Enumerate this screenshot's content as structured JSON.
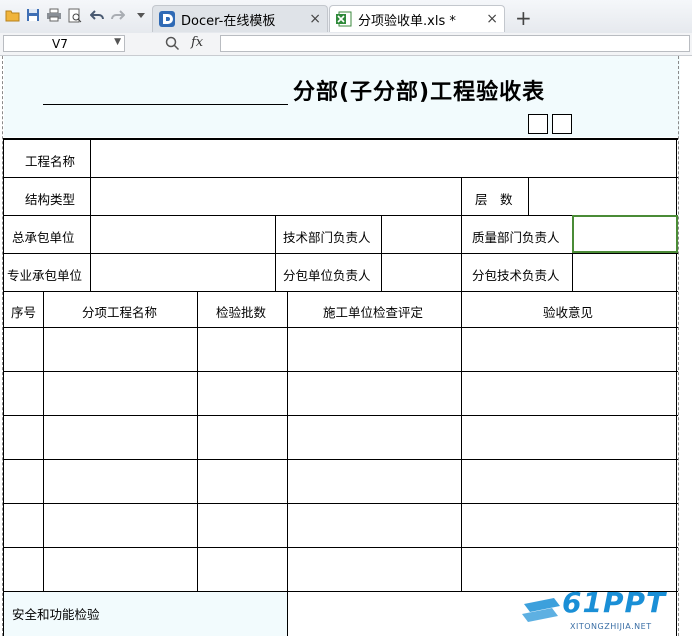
{
  "toolbar": {
    "icons": [
      "open-folder-icon",
      "save-icon",
      "print-icon",
      "print-preview-icon",
      "undo-icon",
      "redo-icon",
      "customize-dropdown-icon"
    ]
  },
  "tabs": [
    {
      "label": "Docer-在线模板",
      "close": "×",
      "active": false
    },
    {
      "label": "分项验收单.xls *",
      "close": "×",
      "active": true
    }
  ],
  "new_tab": "+",
  "formula_bar": {
    "cell_ref": "V7",
    "fx": "fx",
    "content": ""
  },
  "form": {
    "title": "分部(子分部)工程验收表",
    "rows": {
      "project_name": "工程名称",
      "structure_type": "结构类型",
      "floors": "层　数",
      "general_contractor": "总承包单位",
      "tech_dept_head": "技术部门负责人",
      "quality_dept_head": "质量部门负责人",
      "specialty_contractor": "专业承包单位",
      "sub_unit_head": "分包单位负责人",
      "sub_tech_head": "分包技术负责人"
    },
    "columns": {
      "no": "序号",
      "item_name": "分项工程名称",
      "batch_count": "检验批数",
      "unit_check": "施工单位检查评定",
      "acceptance": "验收意见"
    },
    "safety_check": "安全和功能检验"
  },
  "watermark": {
    "brand": "61PPT",
    "site": "XITONGZHIJIA.NET",
    "color": "#1a8fd6"
  }
}
